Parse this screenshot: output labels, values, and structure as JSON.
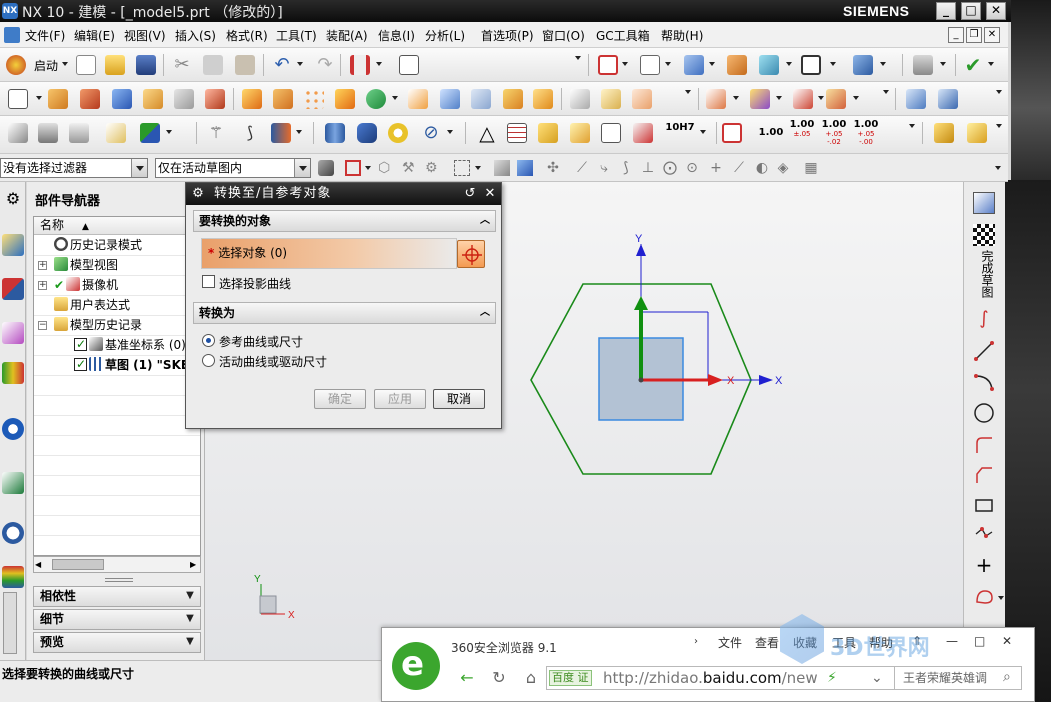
{
  "window": {
    "title": "NX 10 - 建模 - [_model5.prt （修改的）]",
    "brand": "SIEMENS",
    "logo": "NX"
  },
  "menubar": {
    "items": [
      "文件(F)",
      "编辑(E)",
      "视图(V)",
      "插入(S)",
      "格式(R)",
      "工具(T)",
      "装配(A)",
      "信息(I)",
      "分析(L)",
      "首选项(P)",
      "窗口(O)",
      "GC工具箱",
      "帮助(H)"
    ]
  },
  "toolbar1": {
    "start_label": "启动"
  },
  "toolbar3": {
    "tolerances": [
      {
        "value": "1.00",
        "tol": ""
      },
      {
        "value": "1.00",
        "tol": "±.05"
      },
      {
        "value": "1.00",
        "tol": "+.05\n-.02"
      },
      {
        "value": "1.00",
        "tol": "+.05\n-.00"
      }
    ],
    "fit_label": "10H7"
  },
  "selection_bar": {
    "filter_value": "没有选择过滤器",
    "scope_value": "仅在活动草图内"
  },
  "navigator": {
    "title": "部件导航器",
    "column_header": "名称",
    "items": [
      {
        "label": "历史记录模式"
      },
      {
        "label": "模型视图"
      },
      {
        "label": "摄像机"
      },
      {
        "label": "用户表达式"
      },
      {
        "label": "模型历史记录"
      },
      {
        "label": "基准坐标系 (0)"
      },
      {
        "label": "草图 (1) \"SKE"
      }
    ],
    "panels": [
      "相依性",
      "细节",
      "预览"
    ]
  },
  "dialog": {
    "title": "转换至/自参考对象",
    "group1_title": "要转换的对象",
    "select_object_label": "选择对象 (0)",
    "select_projected_label": "选择投影曲线",
    "group2_title": "转换为",
    "radio_reference_label": "参考曲线或尺寸",
    "radio_active_label": "活动曲线或驱动尺寸",
    "ok_label": "确定",
    "apply_label": "应用",
    "cancel_label": "取消"
  },
  "graphics": {
    "axis_y": "Y",
    "axis_x": "X",
    "sketch_x": "X",
    "triad_y": "Y",
    "triad_x": "X",
    "colors": {
      "hexagon": "#1a8a1a",
      "square_fill": "#b3c2d4",
      "square_stroke": "#3a8ae0",
      "axis_blue": "#2020d0",
      "axis_red": "#d82020",
      "axis_green": "#109010"
    }
  },
  "right_toolbar": {
    "finish_sketch_label": "完成草图"
  },
  "status": {
    "message": "选择要转换的曲线或尺寸"
  },
  "browser": {
    "title": "360安全浏览器 9.1",
    "menu": [
      "文件",
      "查看",
      "收藏",
      "工具",
      "帮助"
    ],
    "badge": "百度",
    "badge_verify": "证",
    "url_prefix": "http://zhidao.",
    "url_domain": "baidu.com",
    "url_suffix": "/new",
    "search_placeholder": "王者荣耀英雄调",
    "watermark": "3D世界网"
  }
}
